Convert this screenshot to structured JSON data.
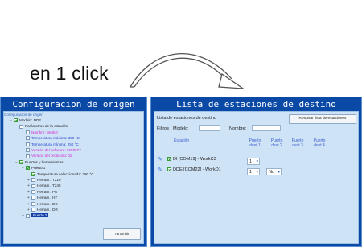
{
  "headline": "en 1 click",
  "left_window": {
    "title": "Configuracion de origen",
    "subtitle": "Configuracion de origen",
    "tree": [
      {
        "label": "Modelo: DDE",
        "level": 1,
        "checkbox": true,
        "checked": true,
        "expander": "−",
        "style": "normal"
      },
      {
        "label": "Parámetros de la estación",
        "level": 2,
        "checkbox": true,
        "checked": false,
        "expander": "−",
        "style": "normal"
      },
      {
        "label": "Nombre: WorkD",
        "level": 3,
        "checkbox": true,
        "checked": false,
        "expander": "",
        "style": "magenta"
      },
      {
        "label": "Temperatura máxima: 350 °C",
        "level": 3,
        "checkbox": true,
        "checked": false,
        "expander": "",
        "style": "blue"
      },
      {
        "label": "Temperatura mínima: 250 °C",
        "level": 3,
        "checkbox": true,
        "checked": false,
        "expander": "",
        "style": "blue"
      },
      {
        "label": "Versión del software: 9999977",
        "level": 3,
        "checkbox": true,
        "checked": false,
        "expander": "",
        "style": "magenta"
      },
      {
        "label": "Versión del protocolo: 02",
        "level": 3,
        "checkbox": true,
        "checked": false,
        "expander": "",
        "style": "magenta"
      },
      {
        "label": "Puertos y herramientas",
        "level": 2,
        "checkbox": true,
        "checked": true,
        "expander": "−",
        "style": "normal"
      },
      {
        "label": "Puerto 1",
        "level": 3,
        "checkbox": true,
        "checked": true,
        "expander": "−",
        "style": "normal"
      },
      {
        "label": "Temperatura seleccionada: 390 °C",
        "level": 4,
        "checkbox": true,
        "checked": true,
        "expander": "",
        "style": "normal"
      },
      {
        "label": "Herram.: T210",
        "level": 4,
        "checkbox": true,
        "checked": false,
        "expander": "+",
        "style": "normal"
      },
      {
        "label": "Herram.: T245",
        "level": 4,
        "checkbox": true,
        "checked": false,
        "expander": "+",
        "style": "normal"
      },
      {
        "label": "Herram.: PA",
        "level": 4,
        "checkbox": true,
        "checked": false,
        "expander": "+",
        "style": "normal"
      },
      {
        "label": "Herram.: HT",
        "level": 4,
        "checkbox": true,
        "checked": false,
        "expander": "+",
        "style": "normal"
      },
      {
        "label": "Herram.: DS",
        "level": 4,
        "checkbox": true,
        "checked": false,
        "expander": "+",
        "style": "normal"
      },
      {
        "label": "Herram.: DR",
        "level": 4,
        "checkbox": true,
        "checked": false,
        "expander": "+",
        "style": "normal"
      },
      {
        "label": "Puerto 2",
        "level": 3,
        "checkbox": true,
        "checked": false,
        "expander": "+",
        "style": "selected"
      }
    ],
    "scan_button": "Tansmitir"
  },
  "right_window": {
    "title": "Lista de estaciones de destino",
    "list_label": "Lista de estaciones de destino",
    "renew_button": "Renovar lista de estaciones",
    "filters_label": "Filtros",
    "model_label": "Modelo:",
    "name_label": "Nombre:",
    "columns": {
      "station": "Estación",
      "dest1": "Puerto dest.1",
      "dest2": "Puerto dest.2",
      "dest3": "Puerto dest.3",
      "dest4": "Puerto dest.4"
    },
    "stations": [
      {
        "name": "DI [COM19] - WorkC3",
        "checked": true,
        "dest1": "1",
        "dest2": ""
      },
      {
        "name": "DDE [COM22] - WorkD1",
        "checked": true,
        "dest1": "1",
        "dest2": "No"
      }
    ]
  },
  "colors": {
    "window_frame": "#0a49a6",
    "window_bg": "#cfe3f7",
    "accent_text": "#3c5fcf",
    "magenta_text": "#d12ad1"
  }
}
